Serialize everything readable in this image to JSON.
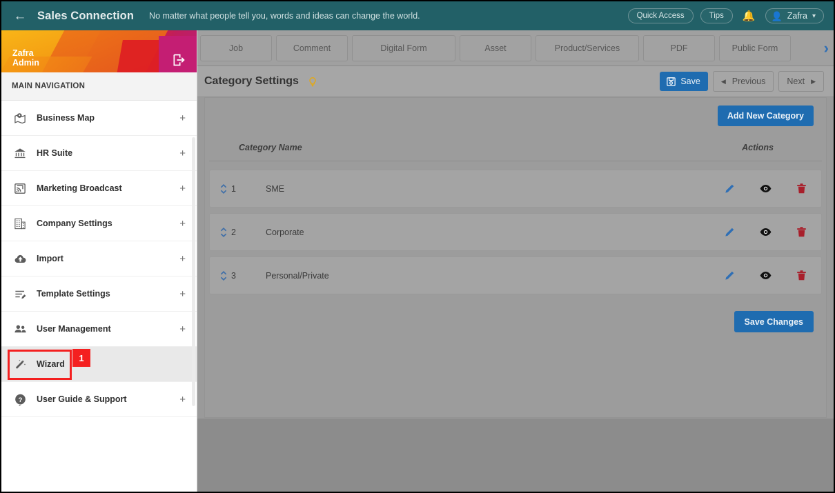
{
  "topbar": {
    "back_icon": "arrow-left-icon",
    "brand": "Sales Connection",
    "tagline": "No matter what people tell you, words and ideas can change the world.",
    "quick_access": "Quick Access",
    "tips": "Tips",
    "bell_icon": "bell-icon",
    "user_name": "Zafra",
    "caret": "⌄",
    "bg_color": "#226067"
  },
  "sidebar": {
    "user": {
      "name": "Zafra",
      "role": "Admin"
    },
    "logout_icon": "logout-icon",
    "nav_title": "MAIN NAVIGATION",
    "items": [
      {
        "label": "Business Map",
        "icon": "map-pin-icon",
        "expand": "+"
      },
      {
        "label": "HR Suite",
        "icon": "bank-icon",
        "expand": "+"
      },
      {
        "label": "Marketing Broadcast",
        "icon": "broadcast-icon",
        "expand": "+"
      },
      {
        "label": "Company Settings",
        "icon": "building-icon",
        "expand": "+"
      },
      {
        "label": "Import",
        "icon": "cloud-upload-icon",
        "expand": "+"
      },
      {
        "label": "Template Settings",
        "icon": "list-edit-icon",
        "expand": "+"
      },
      {
        "label": "User Management",
        "icon": "users-icon",
        "expand": "+"
      },
      {
        "label": "Wizard",
        "icon": "magic-wand-icon",
        "expand": "",
        "active": true,
        "badge": "1"
      },
      {
        "label": "User Guide & Support",
        "icon": "question-badge-icon",
        "expand": "+"
      }
    ],
    "highlight_color": "#f42020"
  },
  "tabs": [
    {
      "label": "Job"
    },
    {
      "label": "Comment"
    },
    {
      "label": "Digital Form"
    },
    {
      "label": "Asset"
    },
    {
      "label": "Product/Services"
    },
    {
      "label": "PDF"
    },
    {
      "label": "Public Form"
    }
  ],
  "tab_next_icon": "chevron-right-icon",
  "pagehead": {
    "title": "Category Settings",
    "hint_icon": "lightbulb-icon",
    "save_label": "Save",
    "save_icon": "floppy-disk-icon",
    "previous_label": "Previous",
    "next_label": "Next",
    "prev_icon": "triangle-left-icon",
    "next_icon": "triangle-right-icon",
    "accent_color": "#1f6cb0"
  },
  "panel": {
    "add_button": "Add New Category",
    "columns": {
      "name": "Category Name",
      "actions": "Actions"
    },
    "rows": [
      {
        "order": "1",
        "name": "SME"
      },
      {
        "order": "2",
        "name": "Corporate"
      },
      {
        "order": "3",
        "name": "Personal/Private"
      }
    ],
    "row_icons": {
      "sort": "sort-updown-icon",
      "edit": "pencil-icon",
      "view": "eye-icon",
      "delete": "trash-icon"
    },
    "save_changes": "Save Changes",
    "edit_color": "#2f6fb5",
    "delete_color": "#a81f2b"
  }
}
